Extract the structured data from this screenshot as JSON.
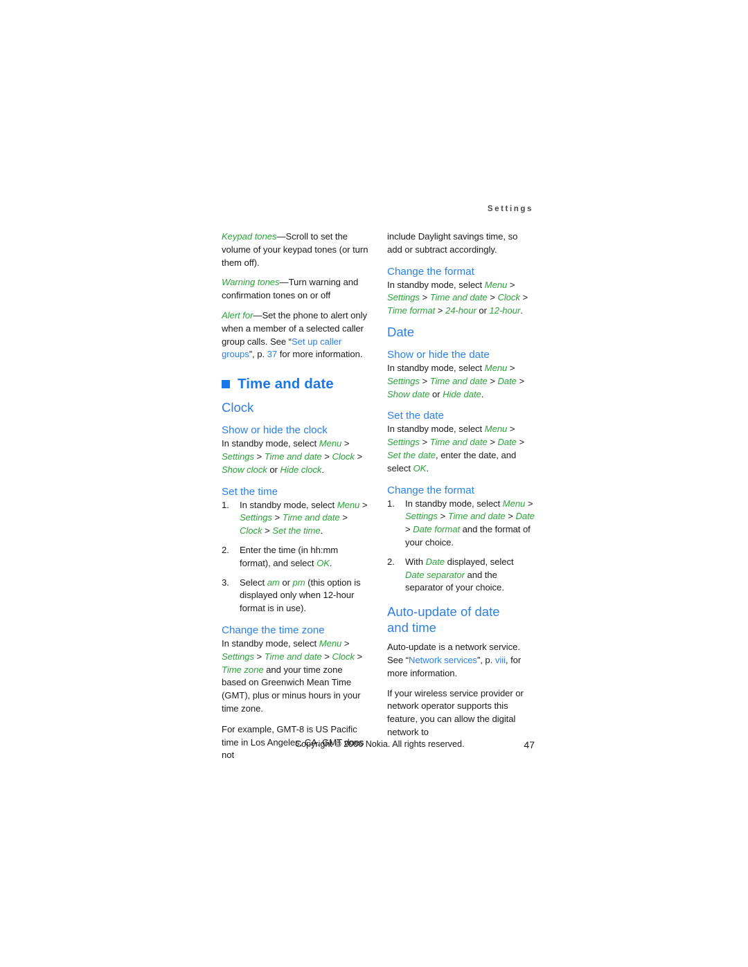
{
  "header": {
    "running_head": "Settings"
  },
  "left_column": {
    "para_keypad_tones": {
      "term": "Keypad tones",
      "body": "—Scroll to set the volume of your keypad tones (or turn them off)."
    },
    "para_warning_tones": {
      "term": "Warning tones",
      "body": "—Turn warning and confirmation tones on or off"
    },
    "para_alert_for": {
      "term": "Alert for",
      "body_1": "—Set the phone to alert only when a member of a selected caller group calls. See “",
      "link_1": "Set up caller groups",
      "body_2": "”, p. ",
      "link_2": "37",
      "body_3": " for more information."
    },
    "heading_time_and_date": "Time and date",
    "heading_clock": "Clock",
    "show_hide_clock": {
      "heading": "Show or hide the clock",
      "lead": "In standby mode, select ",
      "menu": "Menu",
      "sep1": " > ",
      "settings": "Settings",
      "sep2": " > ",
      "time_and_date": "Time and date",
      "sep3": " > ",
      "clock": "Clock",
      "sep4": " > ",
      "option_a": "Show clock",
      "or": " or ",
      "option_b": "Hide clock",
      "period": "."
    },
    "set_the_time": {
      "heading": "Set the time",
      "step1": {
        "lead": "In standby mode, select ",
        "menu": "Menu",
        "sep1": " > ",
        "settings": "Settings",
        "sep2": " > ",
        "time_and_date": "Time and date",
        "sep3": " > ",
        "clock": "Clock",
        "sep4": " > ",
        "set_the_time": "Set the time",
        "period": "."
      },
      "step2": {
        "lead": "Enter the time (in hh:mm format), and select ",
        "ok": "OK",
        "period": "."
      },
      "step3": {
        "lead": "Select ",
        "am": "am",
        "or": " or ",
        "pm": "pm",
        "tail": " (this option is displayed only when 12-hour format is in use)."
      }
    },
    "change_time_zone": {
      "heading": "Change the time zone",
      "lead": "In standby mode, select ",
      "menu": "Menu",
      "sep1": " > ",
      "settings": "Settings",
      "sep2": " > ",
      "time_and_date": "Time and date",
      "sep3": " > ",
      "clock": "Clock",
      "sep4": " > ",
      "time_zone": "Time zone",
      "tail": " and your time zone based on Greenwich Mean Time (GMT), plus or minus hours in your time zone.",
      "example": "For example, GMT-8 is US Pacific time in Los Angeles, CA. GMT does not"
    }
  },
  "right_column": {
    "continued_para": "include Daylight savings time, so add or subtract accordingly.",
    "change_format_time": {
      "heading": "Change the format",
      "lead": "In standby mode, select ",
      "menu": "Menu",
      "sep1": " > ",
      "settings": "Settings",
      "sep2": " > ",
      "time_and_date": "Time and date",
      "sep3": " > ",
      "clock": "Clock",
      "sep4": " > ",
      "time_format": "Time format",
      "sep5": " > ",
      "opt_24": "24-hour",
      "or": " or ",
      "opt_12": "12-hour",
      "period": "."
    },
    "heading_date": "Date",
    "show_hide_date": {
      "heading": "Show or hide the date",
      "lead": "In standby mode, select ",
      "menu": "Menu",
      "sep1": " > ",
      "settings": "Settings",
      "sep2": " > ",
      "time_and_date": "Time and date",
      "sep3": " > ",
      "date": "Date",
      "sep4": " > ",
      "option_a": "Show date",
      "or": " or ",
      "option_b": "Hide date",
      "period": "."
    },
    "set_the_date": {
      "heading": "Set the date",
      "lead": "In standby mode, select ",
      "menu": "Menu",
      "sep1": " > ",
      "settings": "Settings",
      "sep2": " > ",
      "time_and_date": "Time and date",
      "sep3": " > ",
      "date": "Date",
      "sep4": " > ",
      "set_the_date": "Set the date",
      "tail": ", enter the date, and select ",
      "ok": "OK",
      "period": "."
    },
    "change_format_date": {
      "heading": "Change the format",
      "step1": {
        "lead": "In standby mode, select ",
        "menu": "Menu",
        "sep1": " > ",
        "settings": "Settings",
        "sep2": " > ",
        "time_and_date": "Time and date",
        "sep3": " > ",
        "date": "Date",
        "sep4": " > ",
        "date_format": "Date format",
        "tail": " and the format of your choice."
      },
      "step2": {
        "lead": "With ",
        "date": "Date",
        "mid": " displayed, select ",
        "date_separator": "Date separator",
        "tail": " and the separator of your choice."
      }
    },
    "auto_update": {
      "heading_line1": "Auto-update of date",
      "heading_line2": "and time",
      "para1_lead": "Auto-update is a network service. See “",
      "para1_link": "Network services",
      "para1_mid": "”, p. ",
      "para1_link2": "viii",
      "para1_tail": ", for more information.",
      "para2": "If your wireless service provider or network operator supports this feature, you can allow the digital network to"
    }
  },
  "footer": {
    "copyright": "Copyright © 2006 Nokia. All rights reserved.",
    "page_number": "47"
  },
  "colors": {
    "heading_blue": "#2a80e8",
    "accent_blue": "#1878e8",
    "menu_green": "#2aa339",
    "body_text": "#1a1a1a"
  }
}
